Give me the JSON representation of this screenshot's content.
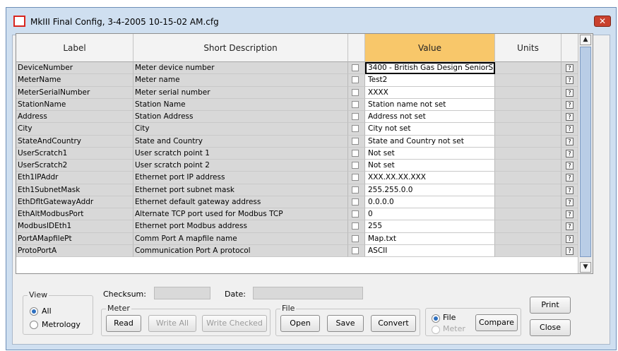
{
  "window": {
    "title": "MkIII Final Config, 3-4-2005 10-15-02 AM.cfg",
    "close_glyph": "✕",
    "accent": "#c9412e"
  },
  "grid": {
    "columns": {
      "label": "Label",
      "desc": "Short Description",
      "value": "Value",
      "units": "Units"
    },
    "header_highlight": "#f8c76a",
    "rows": [
      {
        "label": "DeviceNumber",
        "desc": "Meter device number",
        "value": "3400 - British Gas Design SeniorS",
        "units": ""
      },
      {
        "label": "MeterName",
        "desc": "Meter name",
        "value": "Test2",
        "units": ""
      },
      {
        "label": "MeterSerialNumber",
        "desc": "Meter serial number",
        "value": "XXXX",
        "units": ""
      },
      {
        "label": "StationName",
        "desc": "Station Name",
        "value": "Station name not set",
        "units": ""
      },
      {
        "label": "Address",
        "desc": "Station Address",
        "value": "Address not set",
        "units": ""
      },
      {
        "label": "City",
        "desc": "City",
        "value": "City not set",
        "units": ""
      },
      {
        "label": "StateAndCountry",
        "desc": "State and Country",
        "value": "State and Country not set",
        "units": ""
      },
      {
        "label": "UserScratch1",
        "desc": "User scratch point 1",
        "value": "Not set",
        "units": ""
      },
      {
        "label": "UserScratch2",
        "desc": "User scratch point 2",
        "value": "Not set",
        "units": ""
      },
      {
        "label": "Eth1IPAddr",
        "desc": "Ethernet port IP address",
        "value": "XXX.XX.XX.XXX",
        "units": ""
      },
      {
        "label": "Eth1SubnetMask",
        "desc": "Ethernet port subnet mask",
        "value": "255.255.0.0",
        "units": ""
      },
      {
        "label": "EthDfltGatewayAddr",
        "desc": "Ethernet default gateway address",
        "value": "0.0.0.0",
        "units": ""
      },
      {
        "label": "EthAltModbusPort",
        "desc": "Alternate TCP port used for Modbus TCP",
        "value": "0",
        "units": ""
      },
      {
        "label": "ModbusIDEth1",
        "desc": "Ethernet port Modbus address",
        "value": "255",
        "units": ""
      },
      {
        "label": "PortAMapfilePt",
        "desc": "Comm Port A mapfile name",
        "value": "Map.txt",
        "units": ""
      },
      {
        "label": "ProtoPortA",
        "desc": "Communication Port A protocol",
        "value": "ASCII",
        "units": ""
      }
    ],
    "help_glyph": "?",
    "scroll_up_glyph": "▲",
    "scroll_down_glyph": "▼"
  },
  "view": {
    "legend": "View",
    "all": "All",
    "metrology": "Metrology",
    "selected": "All"
  },
  "checksum": {
    "label": "Checksum:",
    "value": ""
  },
  "date": {
    "label": "Date:",
    "value": ""
  },
  "meter": {
    "legend": "Meter",
    "read": "Read",
    "write_all": "Write All",
    "write_checked": "Write Checked"
  },
  "file": {
    "legend": "File",
    "open": "Open",
    "save": "Save",
    "convert": "Convert"
  },
  "compare": {
    "file": "File",
    "meter": "Meter",
    "compare": "Compare",
    "selected": "File"
  },
  "actions": {
    "print": "Print",
    "close": "Close"
  }
}
